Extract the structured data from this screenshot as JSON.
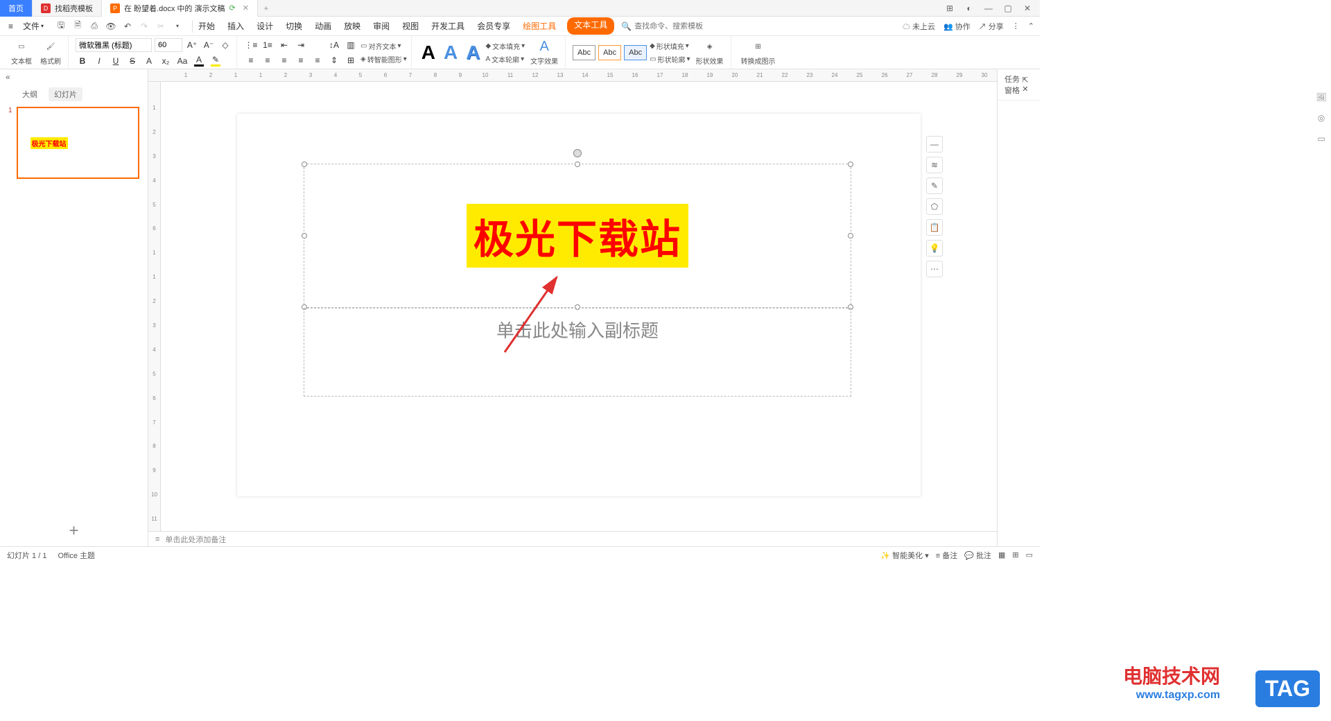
{
  "titlebar": {
    "tabs": [
      {
        "label": "首页",
        "icon": ""
      },
      {
        "label": "找稻壳模板",
        "icon": "D"
      },
      {
        "label": "在 盼望着.docx 中的 演示文稿",
        "icon": "P"
      }
    ]
  },
  "menubar": {
    "file_label": "文件",
    "tabs": [
      "开始",
      "插入",
      "设计",
      "切换",
      "动画",
      "放映",
      "审阅",
      "视图",
      "开发工具",
      "会员专享",
      "绘图工具",
      "文本工具"
    ],
    "active_tab_index": 10,
    "pill_index": 11,
    "search_placeholder": "查找命令、搜索模板",
    "cloud_label": "未上云",
    "coop_label": "协作",
    "share_label": "分享"
  },
  "ribbon": {
    "textbox_label": "文本框",
    "format_brush": "格式刷",
    "font_name": "微软雅黑 (标题)",
    "font_size": "60",
    "align_text_label": "对齐文本",
    "smart_shape_label": "转智能图形",
    "text_fill": "文本填充",
    "text_outline": "文本轮廓",
    "text_effect": "文字效果",
    "abc": "Abc",
    "shape_fill": "形状填充",
    "shape_outline": "形状轮廓",
    "shape_effect": "形状效果",
    "convert_diagram": "转换成图示"
  },
  "sidebar_left": {
    "outline_tab": "大纲",
    "slides_tab": "幻灯片",
    "thumb_num": "1",
    "thumb_text": "极光下载站"
  },
  "canvas": {
    "title_text": "极光下载站",
    "subtitle_text": "单击此处输入副标题"
  },
  "sidebar_right": {
    "title": "任务窗格"
  },
  "notes": {
    "placeholder": "单击此处添加备注"
  },
  "statusbar": {
    "slide_info": "幻灯片 1 / 1",
    "theme": "Office 主题",
    "beautify": "智能美化",
    "notes_btn": "备注",
    "comments_btn": "批注"
  },
  "watermark": {
    "cn": "电脑技术网",
    "url": "www.tagxp.com",
    "tag": "TAG"
  },
  "ruler_h": [
    "1",
    "2",
    "1",
    "1",
    "2",
    "3",
    "4",
    "5",
    "6",
    "7",
    "8",
    "9",
    "10",
    "11",
    "12",
    "13",
    "14",
    "15",
    "16",
    "17",
    "18",
    "19",
    "20",
    "21",
    "22",
    "23",
    "24",
    "25",
    "26",
    "27",
    "28",
    "29",
    "30"
  ],
  "ruler_v": [
    "1",
    "2",
    "3",
    "4",
    "5",
    "6",
    "1",
    "1",
    "2",
    "3",
    "4",
    "5",
    "6",
    "7",
    "8",
    "9",
    "10",
    "11"
  ]
}
